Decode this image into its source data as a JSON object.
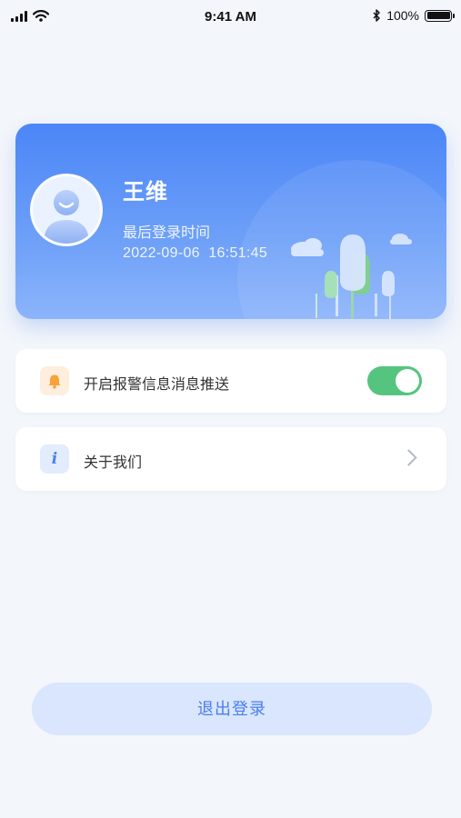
{
  "status_bar": {
    "time": "9:41 AM",
    "battery": "100%",
    "icons": [
      "signal-icon",
      "wifi-icon",
      "bluetooth-icon",
      "battery-icon"
    ]
  },
  "profile": {
    "name": "王维",
    "last_login_label": "最后登录时间",
    "last_login_time": "2022-09-06  16:51:45"
  },
  "menu": {
    "alert_push": {
      "label": "开启报警信息消息推送",
      "icon": "bell-icon",
      "enabled": true
    },
    "about": {
      "label": "关于我们",
      "icon": "info-icon"
    }
  },
  "logout": {
    "label": "退出登录"
  },
  "colors": {
    "card_gradient_top": "#4b86f7",
    "card_gradient_bottom": "#8cb4fb",
    "toggle_on": "#55c47f",
    "accent": "#4a7ef0",
    "bell_bg": "#fdeedd",
    "bell": "#f7a23b",
    "info_bg": "#e3ecfd"
  }
}
